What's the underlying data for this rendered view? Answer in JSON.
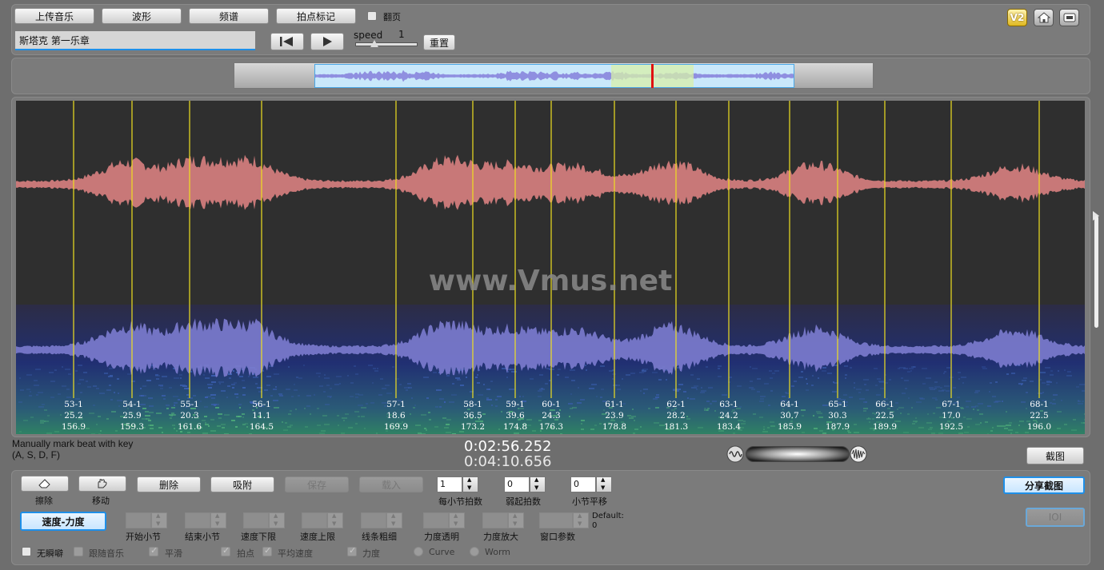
{
  "toolbar": {
    "upload_label": "上传音乐",
    "waveform_label": "波形",
    "spectrum_label": "频谱",
    "beat_mark_label": "拍点标记",
    "flip_label": "翻页",
    "speed_label": "speed",
    "speed_value": "1",
    "reset_label": "重置",
    "song_title": "斯塔克 第一乐章"
  },
  "icons": {
    "v2_label": "V2",
    "home": "home-icon",
    "window": "window-icon"
  },
  "main": {
    "watermark": "www.Vmus.net",
    "beats": [
      {
        "bar": "53-1",
        "tempo": "25.2",
        "time": "156.9"
      },
      {
        "bar": "54-1",
        "tempo": "25.9",
        "time": "159.3"
      },
      {
        "bar": "55-1",
        "tempo": "20.3",
        "time": "161.6"
      },
      {
        "bar": "56-1",
        "tempo": "11.1",
        "time": "164.5"
      },
      {
        "bar": "57-1",
        "tempo": "18.6",
        "time": "169.9"
      },
      {
        "bar": "58-1",
        "tempo": "36.5",
        "time": "173.2"
      },
      {
        "bar": "59-1",
        "tempo": "39.6",
        "time": "174.8"
      },
      {
        "bar": "60-1",
        "tempo": "24.3",
        "time": "176.3"
      },
      {
        "bar": "61-1",
        "tempo": "23.9",
        "time": "178.8"
      },
      {
        "bar": "62-1",
        "tempo": "28.2",
        "time": "181.3"
      },
      {
        "bar": "63-1",
        "tempo": "24.2",
        "time": "183.4"
      },
      {
        "bar": "64-1",
        "tempo": "30.7",
        "time": "185.9"
      },
      {
        "bar": "65-1",
        "tempo": "30.3",
        "time": "187.9"
      },
      {
        "bar": "66-1",
        "tempo": "22.5",
        "time": "189.9"
      },
      {
        "bar": "67-1",
        "tempo": "17.0",
        "time": "192.5"
      },
      {
        "bar": "68-1",
        "tempo": "22.5",
        "time": "196.0"
      }
    ],
    "colors": {
      "waveform_top": "#c87878",
      "waveform_bottom": "#7c7ccf",
      "beat_line": "#f0e020",
      "background": "#2f2f2f"
    }
  },
  "status": {
    "hint_line1": "Manually mark beat with key",
    "hint_line2": "(A, S, D, F)",
    "current_time": "0:02:56.252",
    "total_time": "0:04:10.656",
    "screenshot_label": "截图"
  },
  "controls": {
    "erase_label": "擦除",
    "move_label": "移动",
    "delete_label": "删除",
    "snap_label": "吸附",
    "save_label": "保存",
    "load_label": "载入",
    "beats_per_bar_label": "每小节拍数",
    "beats_per_bar_value": "1",
    "upbeat_label": "弱起拍数",
    "upbeat_value": "0",
    "bar_shift_label": "小节平移",
    "bar_shift_value": "0",
    "share_label": "分享截图",
    "ioi_label": "IOI",
    "speed_force_label": "速度-力度",
    "start_bar_label": "开始小节",
    "end_bar_label": "结束小节",
    "speed_lower_label": "速度下限",
    "speed_upper_label": "速度上限",
    "line_width_label": "线条粗细",
    "force_alpha_label": "力度透明",
    "force_zoom_label": "力度放大",
    "window_param_label": "窗口参数",
    "default_label": "Default:",
    "default_value": "0",
    "silent_label": "无瞬噼",
    "follow_music_label": "跟随音乐",
    "smooth_label": "平滑",
    "beat_label": "拍点",
    "avg_speed_label": "平均速度",
    "force_label": "力度",
    "curve_label": "Curve",
    "worm_label": "Worm"
  }
}
